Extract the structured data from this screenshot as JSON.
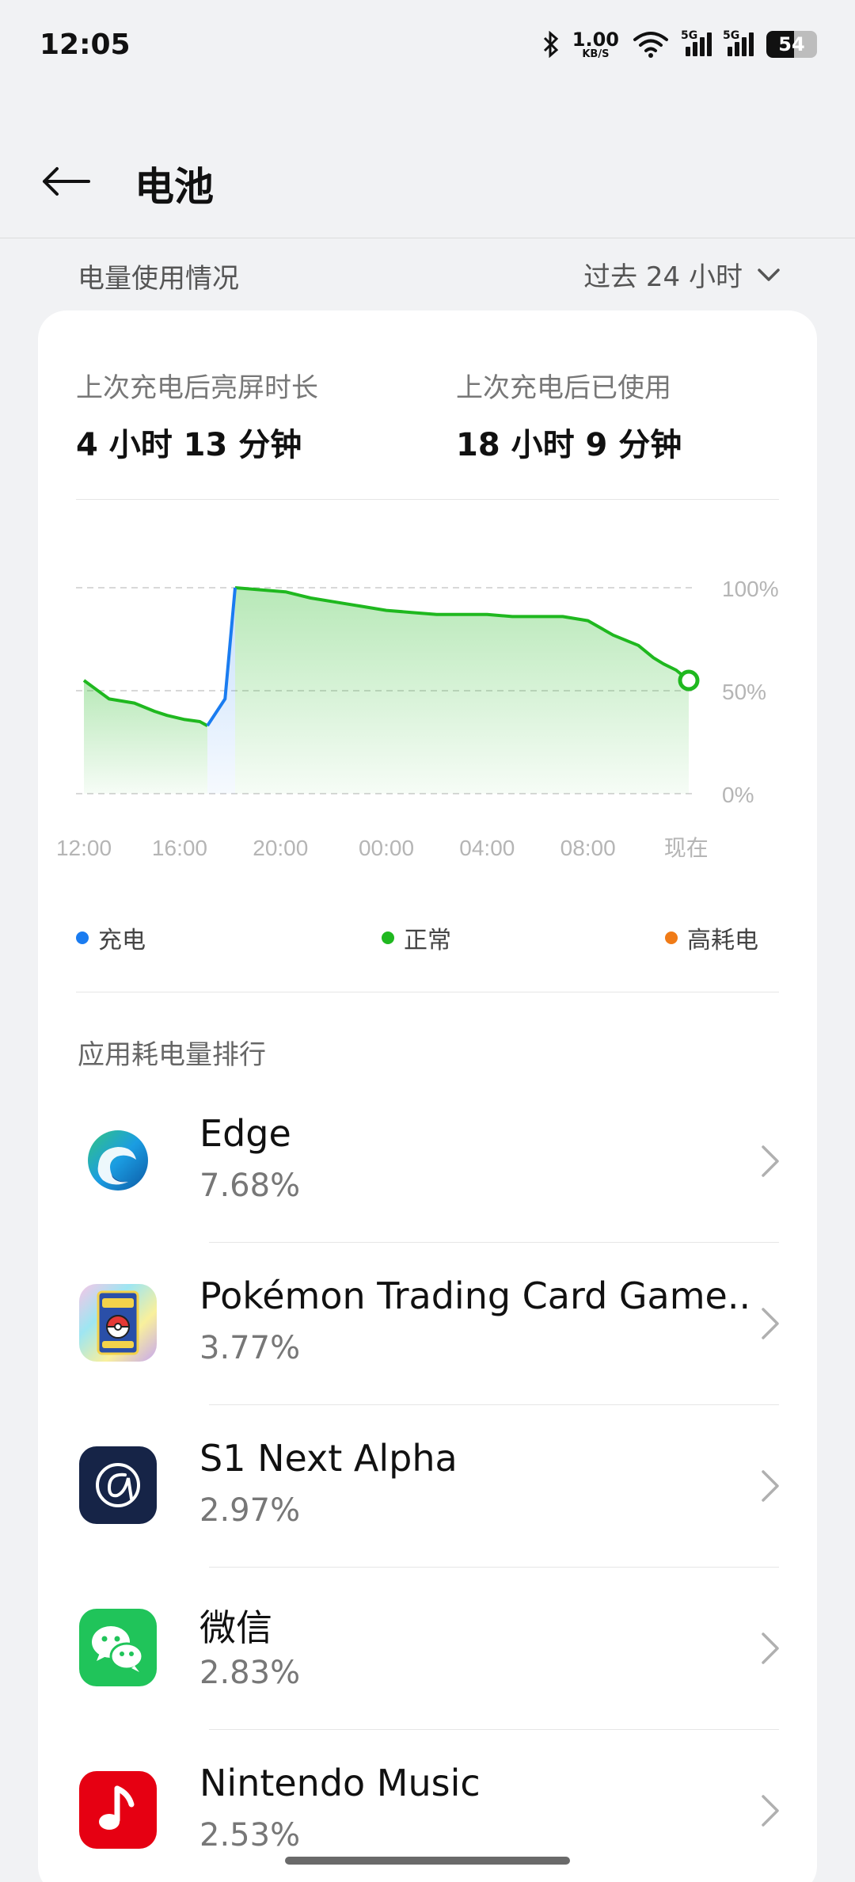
{
  "status_bar": {
    "time": "12:05",
    "net_speed_value": "1.00",
    "net_speed_unit": "KB/S",
    "sim1_label": "5G",
    "sim2_label": "5G",
    "battery_level": "54"
  },
  "header": {
    "title": "电池"
  },
  "usage_section": {
    "title": "电量使用情况",
    "range": "过去 24 小时"
  },
  "summary": {
    "screen_time_label": "上次充电后亮屏时长",
    "screen_time_value": "4 小时 13 分钟",
    "used_since_charge_label": "上次充电后已使用",
    "used_since_charge_value": "18 小时 9 分钟"
  },
  "chart_data": {
    "type": "area",
    "x_ticks": [
      "12:00",
      "16:00",
      "20:00",
      "00:00",
      "04:00",
      "08:00",
      "现在"
    ],
    "y_ticks": [
      "100%",
      "50%",
      "0%"
    ],
    "ylim": [
      0,
      100
    ],
    "series": [
      {
        "name": "充电",
        "color": "#1a7cf0",
        "x": [
          16.9,
          17.6,
          18.0
        ],
        "y": [
          33,
          46,
          100
        ]
      },
      {
        "name": "正常",
        "color": "#1fb81f",
        "x": [
          12.0,
          13.0,
          14.0,
          14.8,
          15.3,
          16.0,
          16.6,
          16.9,
          18.0,
          20.0,
          21.0,
          22.0,
          23.0,
          24.0,
          25.0,
          26.0,
          27.0,
          28.0,
          29.0,
          30.0,
          31.0,
          32.0,
          33.0,
          34.0,
          34.6,
          35.0,
          35.5,
          36.0
        ],
        "y": [
          55,
          46,
          44,
          40,
          38,
          36,
          35,
          33,
          100,
          98,
          95,
          93,
          91,
          89,
          88,
          87,
          87,
          87,
          86,
          86,
          86,
          84,
          77,
          72,
          66,
          63,
          60,
          55
        ]
      }
    ],
    "legend": [
      {
        "label": "充电",
        "color": "#1a7cf0"
      },
      {
        "label": "正常",
        "color": "#1fb81f"
      },
      {
        "label": "高耗电",
        "color": "#f07b17"
      }
    ]
  },
  "ranking": {
    "title": "应用耗电量排行",
    "apps": [
      {
        "name": "Edge",
        "percent": "7.68%",
        "icon": "edge-icon"
      },
      {
        "name": "Pokémon Trading Card Game..",
        "percent": "3.77%",
        "icon": "pokemon-tcg-icon"
      },
      {
        "name": "S1 Next Alpha",
        "percent": "2.97%",
        "icon": "s1-next-icon"
      },
      {
        "name": "微信",
        "percent": "2.83%",
        "icon": "wechat-icon"
      },
      {
        "name": "Nintendo Music",
        "percent": "2.53%",
        "icon": "nintendo-music-icon"
      }
    ]
  }
}
